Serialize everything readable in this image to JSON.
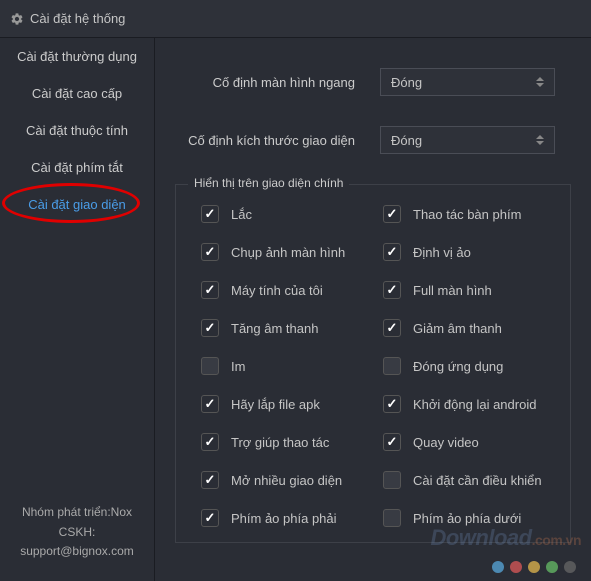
{
  "header": {
    "title": "Cài đặt hệ thống"
  },
  "sidebar": {
    "items": [
      {
        "label": "Cài đặt thường dụng"
      },
      {
        "label": "Cài đặt cao cấp"
      },
      {
        "label": "Cài đặt thuộc tính"
      },
      {
        "label": "Cài đặt phím tắt"
      },
      {
        "label": "Cài đặt giao diện"
      }
    ],
    "footer": {
      "line1": "Nhóm phát triển:Nox",
      "line2": "CSKH:",
      "line3": "support@bignox.com"
    }
  },
  "content": {
    "row1": {
      "label": "Cố định màn hình ngang",
      "value": "Đóng"
    },
    "row2": {
      "label": "Cố định kích thước giao diện",
      "value": "Đóng"
    },
    "fieldset_title": "Hiển thị trên giao diện chính",
    "checks": [
      {
        "label": "Lắc",
        "checked": true
      },
      {
        "label": "Thao tác bàn phím",
        "checked": true
      },
      {
        "label": "Chụp ảnh màn hình",
        "checked": true
      },
      {
        "label": "Định vị ảo",
        "checked": true
      },
      {
        "label": "Máy tính của tôi",
        "checked": true
      },
      {
        "label": "Full màn hình",
        "checked": true
      },
      {
        "label": "Tăng âm thanh",
        "checked": true
      },
      {
        "label": "Giảm âm thanh",
        "checked": true
      },
      {
        "label": "Im",
        "checked": false
      },
      {
        "label": "Đóng ứng dụng",
        "checked": false
      },
      {
        "label": "Hãy lắp file apk",
        "checked": true
      },
      {
        "label": "Khởi động lại android",
        "checked": true
      },
      {
        "label": "Trợ giúp thao tác",
        "checked": true
      },
      {
        "label": "Quay video",
        "checked": true
      },
      {
        "label": "Mở nhiều giao diện",
        "checked": true
      },
      {
        "label": "Cài đặt cần điều khiển",
        "checked": false
      },
      {
        "label": "Phím ảo phía phải",
        "checked": true
      },
      {
        "label": "Phím ảo phía dưới",
        "checked": false
      }
    ]
  },
  "watermark": {
    "main": "Download",
    "suffix": ".com.vn"
  },
  "dots": [
    "#5bb0e8",
    "#e85b5b",
    "#f0c050",
    "#6bc86b",
    "#6b6b6b"
  ]
}
